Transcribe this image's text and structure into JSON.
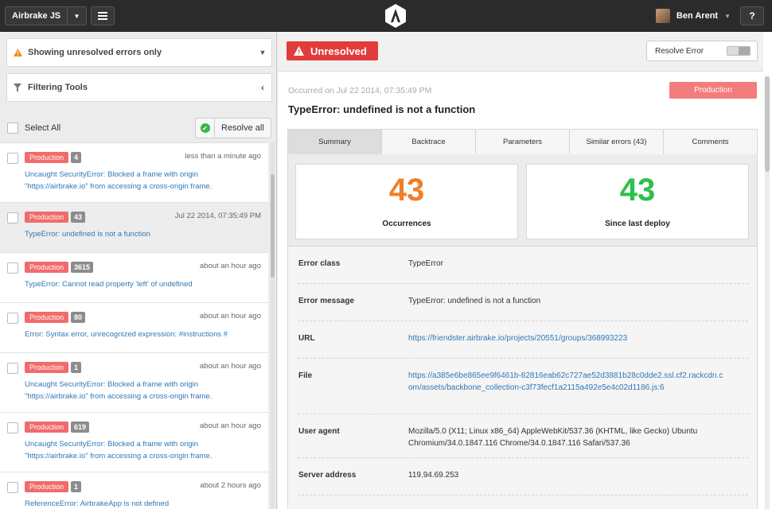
{
  "topbar": {
    "project": "Airbrake JS",
    "user_name": "Ben Arent",
    "help_label": "?"
  },
  "filters": {
    "status_filter": "Showing unresolved errors only",
    "tools_label": "Filtering Tools",
    "select_all": "Select All",
    "resolve_all": "Resolve all"
  },
  "errors": [
    {
      "env": "Production",
      "count": "4",
      "time": "less than a minute ago",
      "message": "Uncaught SecurityError: Blocked a frame with origin \"https://airbrake.io\" from accessing a cross-origin frame."
    },
    {
      "env": "Production",
      "count": "43",
      "time": "Jul 22 2014, 07:35:49 PM",
      "message": "TypeError: undefined is not a function"
    },
    {
      "env": "Production",
      "count": "3615",
      "time": "about an hour ago",
      "message": "TypeError: Cannot read property 'left' of undefined"
    },
    {
      "env": "Production",
      "count": "80",
      "time": "about an hour ago",
      "message": "Error: Syntax error, unrecognized expression: #instructions #"
    },
    {
      "env": "Production",
      "count": "1",
      "time": "about an hour ago",
      "message": "Uncaught SecurityError: Blocked a frame with origin \"https://airbrake.io\" from accessing a cross-origin frame."
    },
    {
      "env": "Production",
      "count": "619",
      "time": "about an hour ago",
      "message": "Uncaught SecurityError: Blocked a frame with origin \"https://airbrake.io\" from accessing a cross-origin frame."
    },
    {
      "env": "Production",
      "count": "1",
      "time": "about 2 hours ago",
      "message": "ReferenceError: AirbrakeApp is not defined"
    }
  ],
  "detail": {
    "status": "Unresolved",
    "resolve_label": "Resolve Error",
    "occurred": "Occurred on Jul 22 2014, 07:35:49 PM",
    "environment": "Production",
    "title": "TypeError: undefined is not a function",
    "tabs": [
      "Summary",
      "Backtrace",
      "Parameters",
      "Similar errors (43)",
      "Comments"
    ],
    "occurrences": {
      "value": "43",
      "label": "Occurrences",
      "color": "#f07f2a"
    },
    "since_deploy": {
      "value": "43",
      "label": "Since last deploy",
      "color": "#2cc14a"
    },
    "fields": [
      {
        "key": "Error class",
        "value": "TypeError"
      },
      {
        "key": "Error message",
        "value": "TypeError: undefined is not a function"
      },
      {
        "key": "URL",
        "value": "https://friendster.airbrake.io/projects/20551/groups/368993223"
      },
      {
        "key": "File",
        "value": "https://a385e6be865ee9f6461b-82816eab62c727ae52d3881b28c0dde2.ssl.cf2.rackcdn.com/assets/backbone_collection-c3f73fecf1a2115a492e5e4c02d1186.js:6"
      },
      {
        "key": "User agent",
        "value": "Mozilla/5.0 (X11; Linux x86_64) AppleWebKit/537.36 (KHTML, like Gecko) Ubuntu Chromium/34.0.1847.116 Chrome/34.0.1847.116 Safari/537.36"
      },
      {
        "key": "Server address",
        "value": "119.94.69.253"
      }
    ]
  },
  "colors": {
    "accent_red": "#e23b3b",
    "production_badge": "#f26b6b",
    "link": "#2f78b7"
  }
}
